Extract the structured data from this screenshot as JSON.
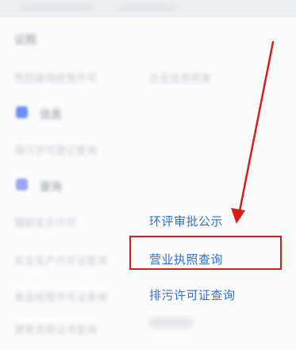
{
  "blurred": {
    "section_title": "证照",
    "row1_left": "危险废物经营许可",
    "row1_right": "企业信息核查",
    "section2_title": "信息",
    "row2_left": "排污许可登记查询",
    "section3_title": "查询",
    "row3_left": "辐射安全许可",
    "row4_left": "安全生产许可证查询",
    "row5_left": "食品经营许可证查询",
    "row6_left": "建筑资质证书查询"
  },
  "items": [
    {
      "label": "环评审批公示"
    },
    {
      "label": "营业执照查询"
    },
    {
      "label": "排污许可证查询"
    }
  ],
  "colors": {
    "link": "#2f6fd6",
    "annotation": "#d91e18"
  },
  "annotation": {
    "type": "arrow-and-box",
    "target": "营业执照查询"
  }
}
